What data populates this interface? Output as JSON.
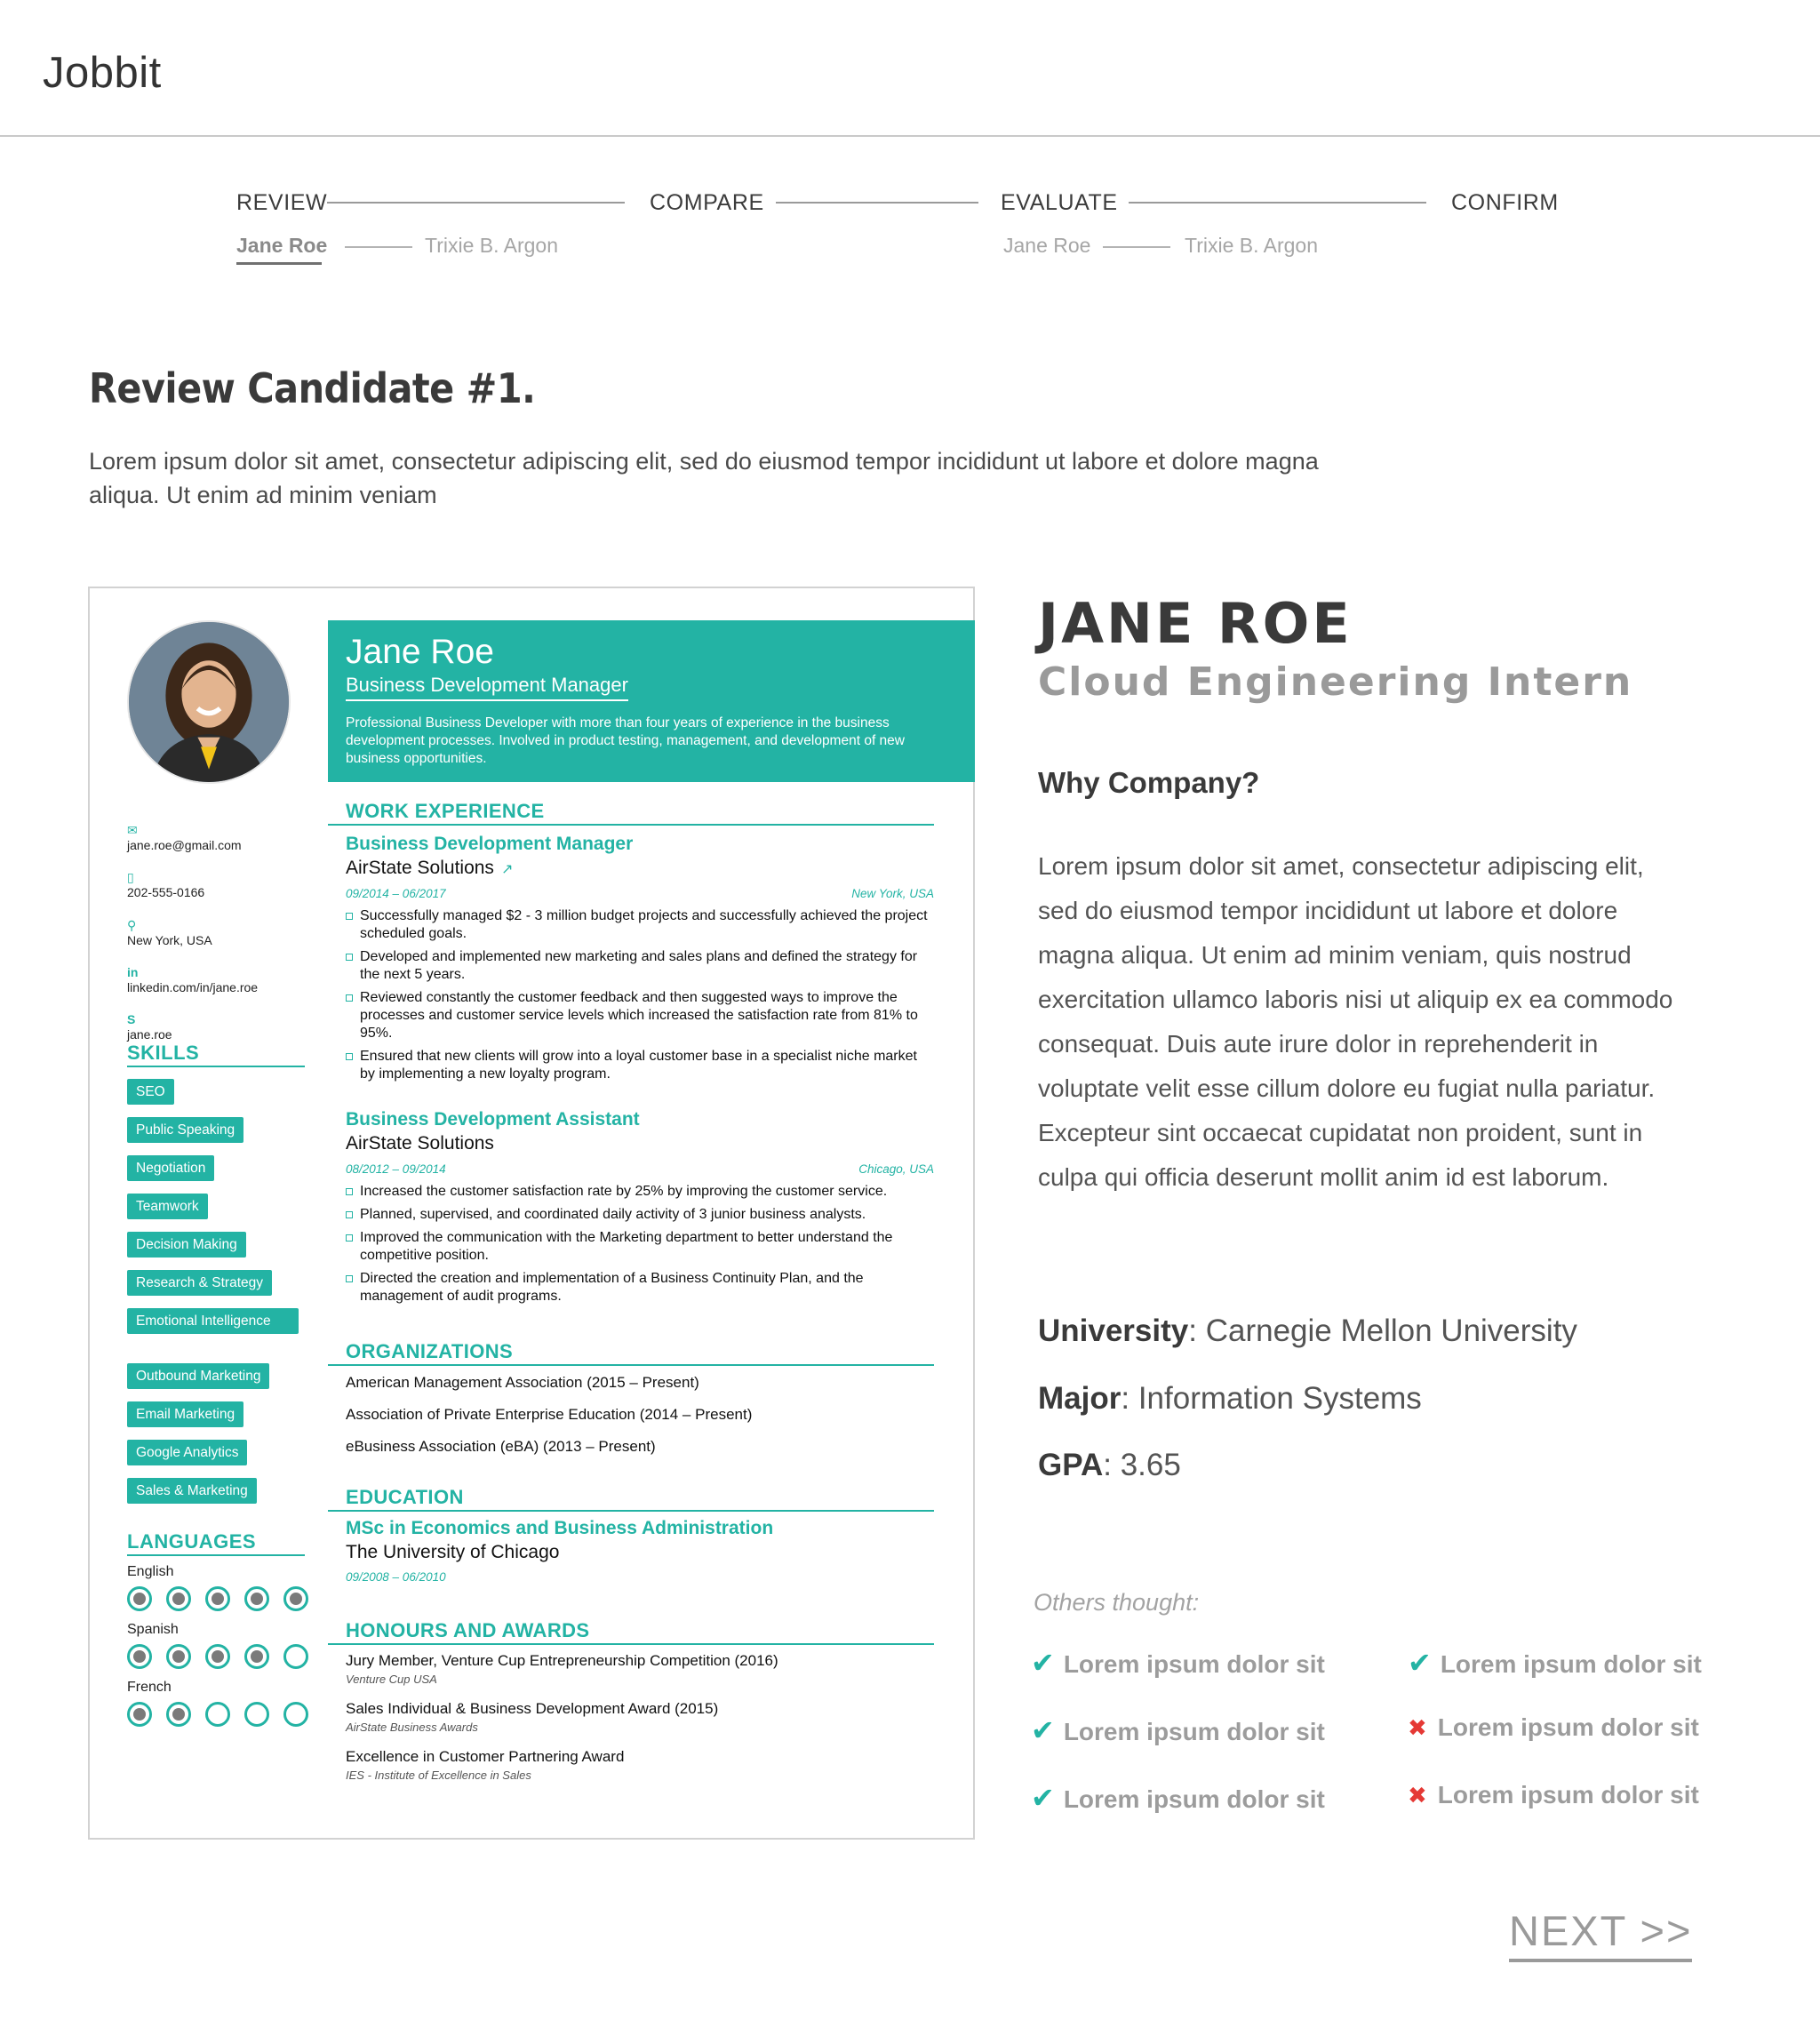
{
  "app": {
    "logo": "Jobbit"
  },
  "stepper": {
    "steps": [
      "REVIEW",
      "COMPARE",
      "EVALUATE",
      "CONFIRM"
    ],
    "review_subs": [
      "Jane Roe",
      "Trixie B. Argon"
    ],
    "evaluate_subs": [
      "Jane Roe",
      "Trixie B. Argon"
    ]
  },
  "intro": {
    "title": "Review Candidate #1.",
    "text": "Lorem ipsum dolor sit amet, consectetur adipiscing elit, sed do eiusmod tempor incididunt ut labore et dolore magna aliqua. Ut enim ad minim veniam"
  },
  "resume": {
    "name": "Jane Roe",
    "role": "Business Development Manager",
    "summary": "Professional Business Developer with more than four years of experience in the business development processes. Involved in product testing, management, and development of new business opportunities.",
    "contact": {
      "email": "jane.roe@gmail.com",
      "phone": "202-555-0166",
      "location": "New York, USA",
      "linkedin": "linkedin.com/in/jane.roe",
      "skype": "jane.roe"
    },
    "skills_heading": "SKILLS",
    "skills": [
      "SEO",
      "Public Speaking",
      "Negotiation",
      "Teamwork",
      "Decision Making",
      "Research & Strategy",
      "Emotional Intelligence",
      "Outbound Marketing",
      "Email Marketing",
      "Google Analytics",
      "Sales & Marketing"
    ],
    "languages_heading": "LANGUAGES",
    "languages": [
      {
        "name": "English",
        "level": 5
      },
      {
        "name": "Spanish",
        "level": 4
      },
      {
        "name": "French",
        "level": 2
      }
    ],
    "work_heading": "WORK EXPERIENCE",
    "jobs": [
      {
        "title": "Business Development Manager",
        "company": "AirState Solutions",
        "dates": "09/2014 – 06/2017",
        "location": "New York, USA",
        "bullets": [
          "Successfully managed $2 - 3 million budget projects and successfully achieved the project scheduled goals.",
          "Developed and implemented new marketing and sales plans and defined the strategy for the next 5 years.",
          "Reviewed constantly the customer feedback and then suggested ways to improve the processes and customer service levels which increased the satisfaction rate from 81% to 95%.",
          "Ensured that new clients will grow into a loyal customer base in a specialist niche market by implementing a new loyalty program."
        ]
      },
      {
        "title": "Business Development Assistant",
        "company": "AirState Solutions",
        "dates": "08/2012 – 09/2014",
        "location": "Chicago, USA",
        "bullets": [
          "Increased the customer satisfaction rate by 25% by improving the customer service.",
          "Planned, supervised, and coordinated daily activity of 3 junior business analysts.",
          "Improved the communication with the Marketing department to better understand the competitive position.",
          "Directed the creation and implementation of a Business Continuity Plan, and the management of audit programs."
        ]
      }
    ],
    "org_heading": "ORGANIZATIONS",
    "organizations": [
      "American Management Association (2015 – Present)",
      "Association of Private Enterprise Education (2014 – Present)",
      "eBusiness Association (eBA) (2013 – Present)"
    ],
    "edu_heading": "EDUCATION",
    "education": {
      "degree": "MSc in Economics and Business Administration",
      "school": "The University of Chicago",
      "dates": "09/2008 – 06/2010"
    },
    "awards_heading": "HONOURS AND AWARDS",
    "awards": [
      {
        "title": "Jury Member, Venture Cup Entrepreneurship Competition (2016)",
        "org": "Venture Cup USA"
      },
      {
        "title": "Sales Individual & Business Development Award (2015)",
        "org": "AirState Business Awards"
      },
      {
        "title": "Excellence in Customer Partnering Award",
        "org": "IES - Institute of Excellence in Sales"
      }
    ]
  },
  "candidate": {
    "name": "JANE ROE",
    "role": "Cloud Engineering Intern",
    "why_heading": "Why Company?",
    "why_text": "Lorem ipsum dolor sit amet, consectetur adipiscing elit, sed do eiusmod tempor incididunt ut labore et dolore magna aliqua. Ut enim ad minim veniam, quis nostrud exercitation ullamco laboris nisi ut aliquip ex ea commodo consequat. Duis aute irure dolor in reprehenderit in voluptate velit esse cillum dolore eu fugiat nulla pariatur. Excepteur sint occaecat cupidatat non proident, sunt in culpa qui officia deserunt mollit anim id est laborum.",
    "university_label": "University",
    "university": "Carnegie Mellon University",
    "major_label": "Major",
    "major": "Information Systems",
    "gpa_label": "GPA",
    "gpa": "3.65",
    "others_heading": "Others thought:",
    "opinions": [
      {
        "text": "Lorem ipsum dolor sit",
        "positive": true
      },
      {
        "text": "Lorem ipsum dolor sit",
        "positive": true
      },
      {
        "text": "Lorem ipsum dolor sit",
        "positive": true
      },
      {
        "text": "Lorem ipsum dolor sit",
        "positive": false
      },
      {
        "text": "Lorem ipsum dolor sit",
        "positive": true
      },
      {
        "text": "Lorem ipsum dolor sit",
        "positive": false
      }
    ]
  },
  "nav": {
    "next_label": "NEXT >>"
  },
  "colors": {
    "accent": "#23b3a4",
    "negative": "#e53935"
  }
}
